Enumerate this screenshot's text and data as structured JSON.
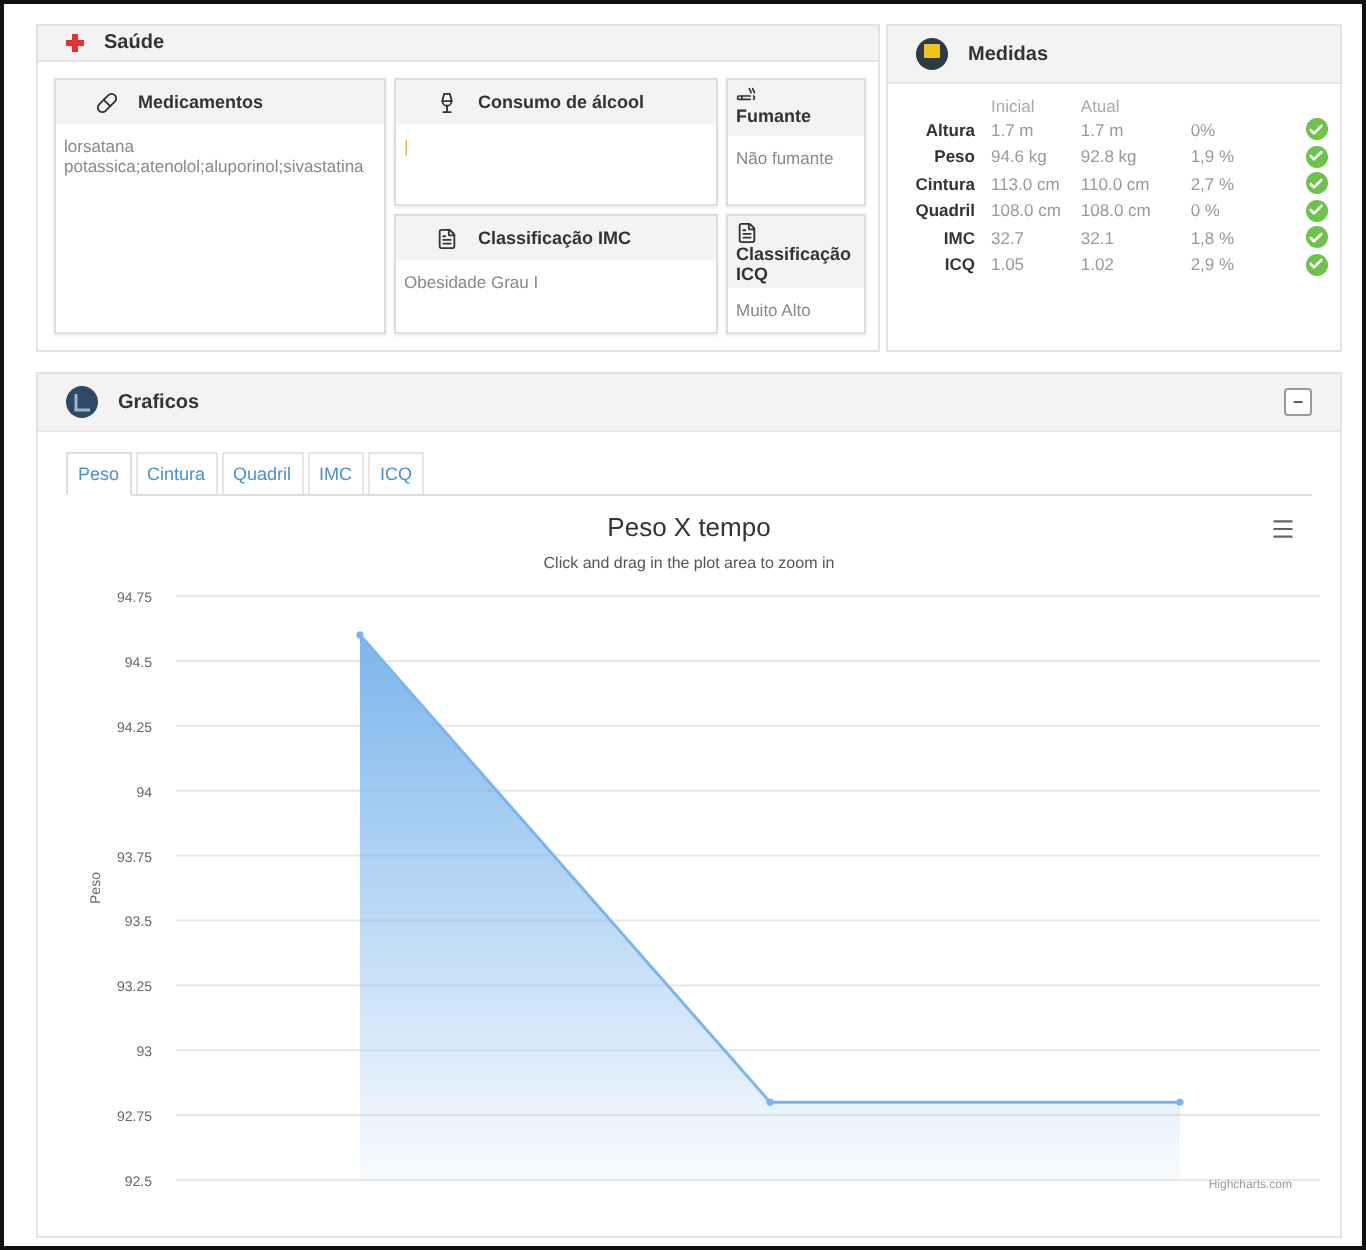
{
  "saude": {
    "title": "Saúde",
    "cards": [
      {
        "kind": "medication",
        "title": "Medicamentos",
        "value": "lorsatana potassica;atenolol;aluporinol;sivastatina"
      },
      {
        "kind": "alcohol",
        "title": "Consumo de álcool",
        "value": "|"
      },
      {
        "kind": "smoking",
        "title": "Fumante",
        "value": "Não fumante"
      },
      {
        "kind": "imc",
        "title": "Classificação IMC",
        "value": "Obesidade Grau I"
      },
      {
        "kind": "icq",
        "title": "Classificação ICQ",
        "value": "Muito Alto"
      }
    ]
  },
  "medidas": {
    "title": "Medidas",
    "columns": [
      "Inicial",
      "Atual"
    ],
    "rows": [
      {
        "label": "Altura",
        "inicial": "1.7 m",
        "atual": "1.7 m",
        "variacao": "0%",
        "ok": true
      },
      {
        "label": "Peso",
        "inicial": "94.6 kg",
        "atual": "92.8 kg",
        "variacao": "1,9 %",
        "ok": true
      },
      {
        "label": "Cintura",
        "inicial": "113.0 cm",
        "atual": "110.0 cm",
        "variacao": "2,7 %",
        "ok": true
      },
      {
        "label": "Quadril",
        "inicial": "108.0 cm",
        "atual": "108.0 cm",
        "variacao": "0 %",
        "ok": true
      },
      {
        "label": "IMC",
        "inicial": "32.7",
        "atual": "32.1",
        "variacao": "1,8 %",
        "ok": true
      },
      {
        "label": "ICQ",
        "inicial": "1.05",
        "atual": "1.02",
        "variacao": "2,9 %",
        "ok": true
      }
    ]
  },
  "graficos": {
    "title": "Graficos",
    "collapse": "−",
    "tabs": [
      {
        "label": "Peso",
        "selected": true
      },
      {
        "label": "Cintura",
        "selected": false
      },
      {
        "label": "Quadril",
        "selected": false
      },
      {
        "label": "IMC",
        "selected": false
      },
      {
        "label": "ICQ",
        "selected": false
      }
    ],
    "subtitle": "Click and drag in the plot area to zoom in",
    "credits": "Highcharts.com",
    "chart_data": {
      "type": "area",
      "grid": true,
      "title": "Peso X tempo",
      "ylabel": "Peso",
      "values": [
        94.6,
        92.8,
        92.8
      ],
      "ylim": [
        92.5,
        94.75
      ],
      "yticks": [
        92.5,
        92.75,
        93,
        93.25,
        93.5,
        93.75,
        94,
        94.25,
        94.5,
        94.75
      ]
    }
  }
}
